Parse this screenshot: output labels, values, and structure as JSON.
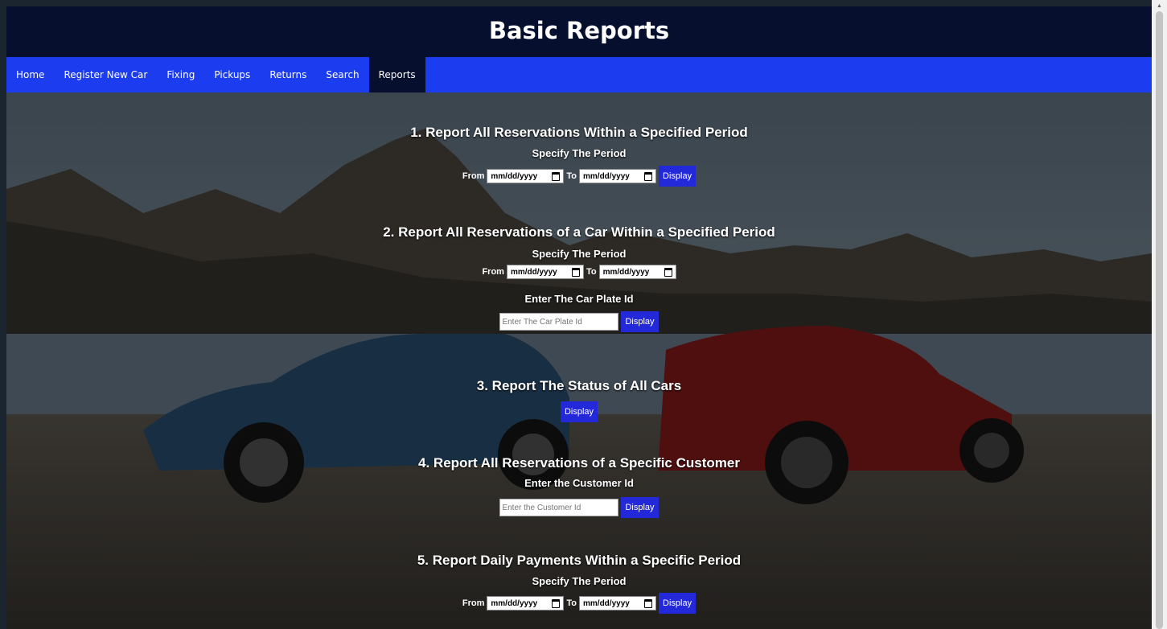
{
  "header": {
    "title": "Basic Reports"
  },
  "nav": {
    "items": [
      "Home",
      "Register New Car",
      "Fixing",
      "Pickups",
      "Returns",
      "Search",
      "Reports"
    ],
    "active": "Reports"
  },
  "colors": {
    "header_bg": "#060f2e",
    "nav_bg": "#1c3cf0",
    "button_bg": "#2328d8"
  },
  "sections": {
    "s1": {
      "title": "1. Report All Reservations Within a Specified Period",
      "sub": "Specify The Period",
      "from_label": "From",
      "to_label": "To",
      "from_value": "mm/dd/yyyy",
      "to_value": "mm/dd/yyyy",
      "button": "Display"
    },
    "s2": {
      "title": "2. Report All Reservations of a Car Within a Specified Period",
      "sub": "Specify The Period",
      "from_label": "From",
      "to_label": "To",
      "from_value": "mm/dd/yyyy",
      "to_value": "mm/dd/yyyy",
      "plate_label": "Enter The Car Plate Id",
      "plate_placeholder": "Enter The Car Plate Id",
      "button": "Display"
    },
    "s3": {
      "title": "3. Report The Status of All Cars",
      "button": "Display"
    },
    "s4": {
      "title": "4. Report All Reservations of a Specific Customer",
      "sub": "Enter the Customer Id",
      "customer_placeholder": "Enter the Customer Id",
      "button": "Display"
    },
    "s5": {
      "title": "5. Report Daily Payments Within a Specific Period",
      "sub": "Specify The Period",
      "from_label": "From",
      "to_label": "To",
      "from_value": "mm/dd/yyyy",
      "to_value": "mm/dd/yyyy",
      "button": "Display"
    }
  }
}
